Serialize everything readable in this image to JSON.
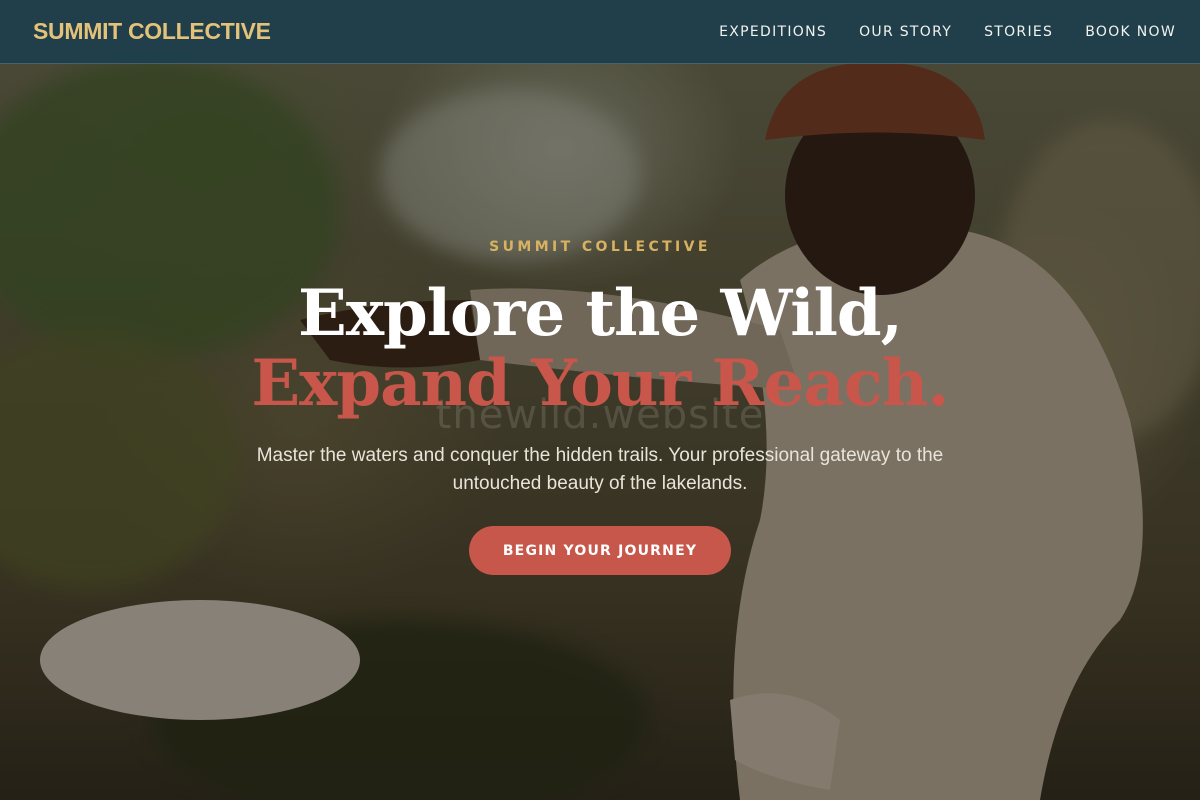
{
  "navbar": {
    "brand": "SUMMIT COLLECTIVE",
    "links": [
      {
        "label": "EXPEDITIONS"
      },
      {
        "label": "OUR STORY"
      },
      {
        "label": "STORIES"
      },
      {
        "label": "BOOK NOW"
      }
    ]
  },
  "hero": {
    "eyebrow": "SUMMIT COLLECTIVE",
    "headline_line1": "Explore the Wild,",
    "headline_line2": "Expand Your Reach.",
    "watermark": "thewild.website",
    "subtitle": "Master the waters and conquer the hidden trails. Your professional gateway to the untouched beauty of the lakelands.",
    "cta_label": "BEGIN YOUR JOURNEY"
  },
  "colors": {
    "navbar_bg": "#1e3e4c",
    "brand": "#e3c27a",
    "eyebrow": "#d8b260",
    "accent": "#c8574b",
    "headline": "#ffffff"
  }
}
